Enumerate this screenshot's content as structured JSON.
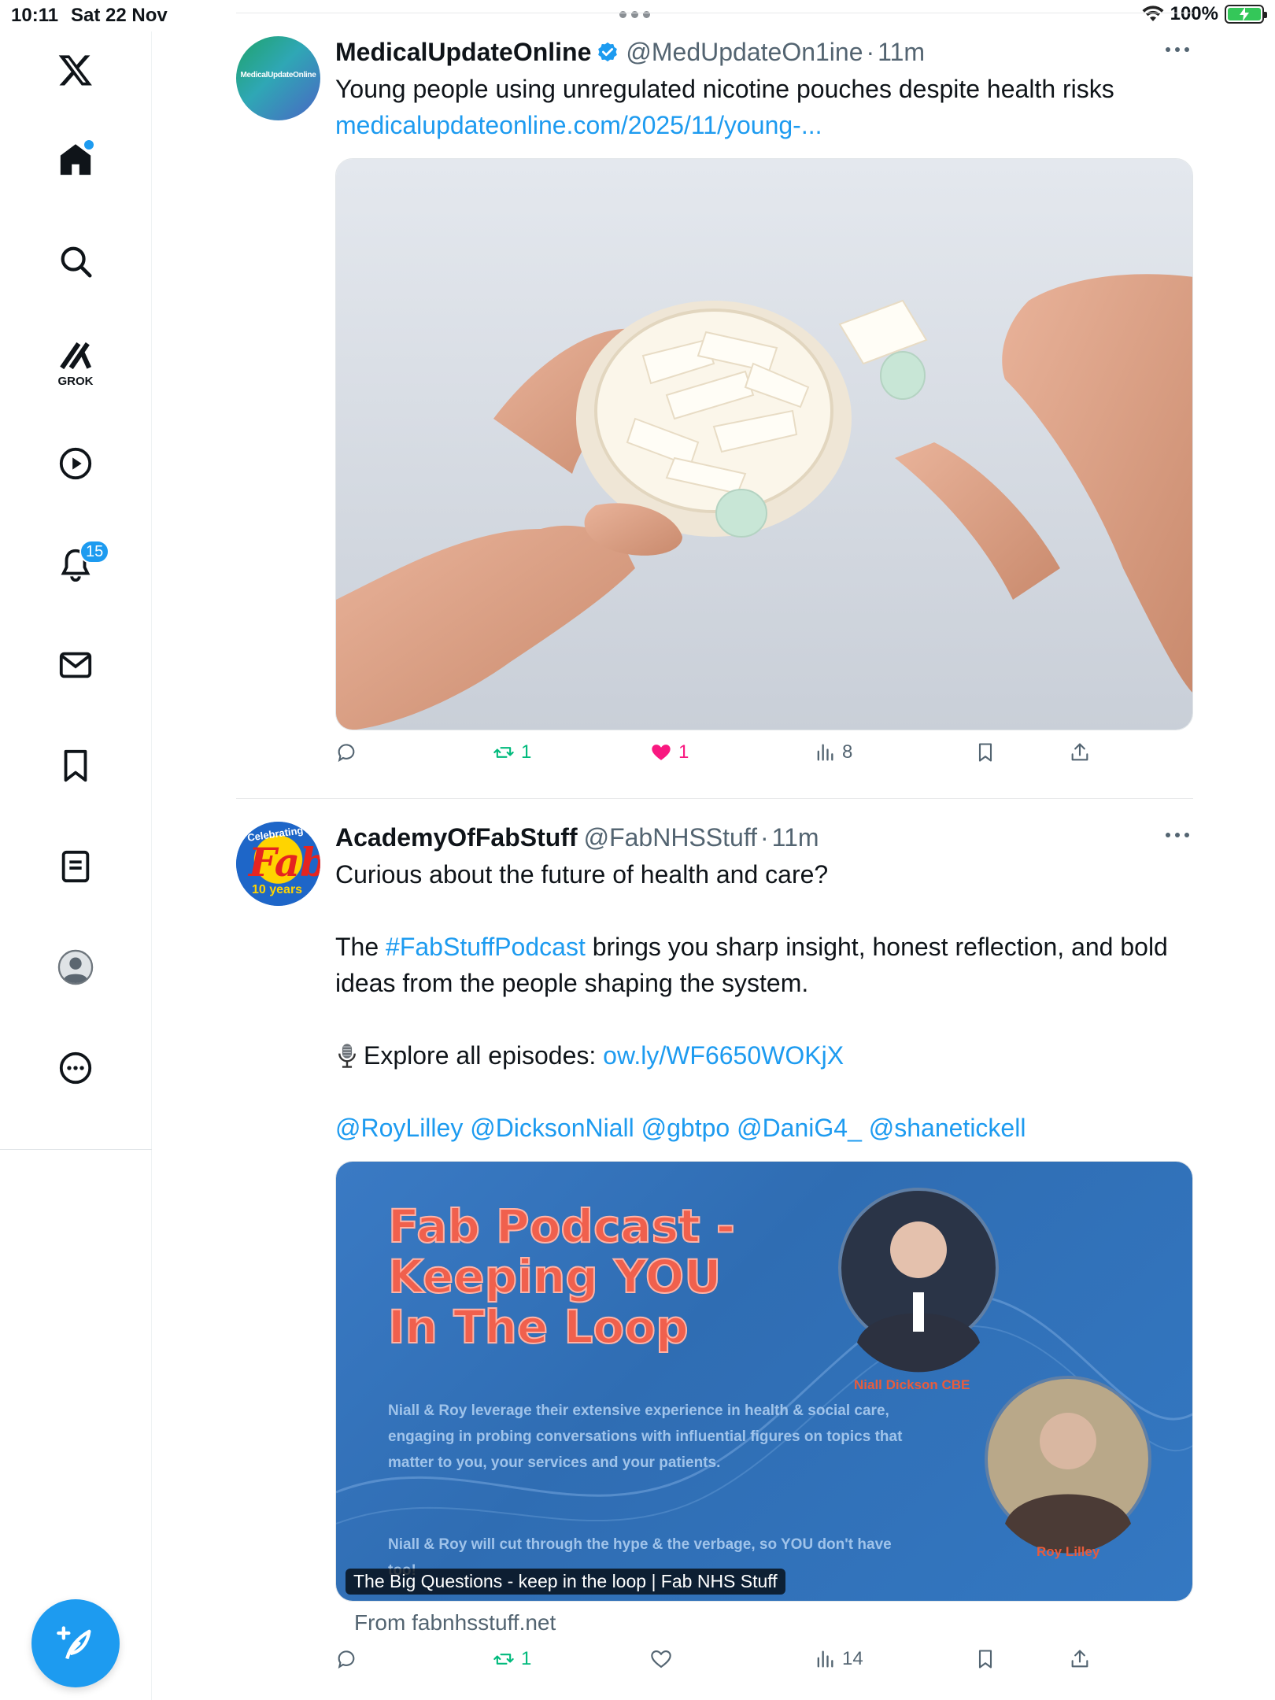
{
  "status_bar": {
    "time": "10:11",
    "date": "Sat 22 Nov",
    "battery": "100%"
  },
  "sidebar": {
    "grok_label": "GROK",
    "notifications_badge": "15",
    "items": [
      "x-logo",
      "home",
      "search",
      "grok",
      "video",
      "notifications",
      "messages",
      "bookmarks",
      "lists",
      "profile",
      "more"
    ]
  },
  "colors": {
    "accent": "#1d9bf0",
    "like": "#f91880",
    "retweet": "#00ba7c",
    "secondary_text": "#536471"
  },
  "posts": [
    {
      "display_name": "MedicalUpdateOnline",
      "verified": true,
      "handle": "@MedUpdateOn1ine",
      "time": "11m",
      "text": "Young people using unregulated nicotine pouches despite health risks",
      "link": "medicalupdateonline.com/2025/11/young-...",
      "avatar_text": "MedicalUpdateOnline",
      "stats": {
        "replies": "",
        "reposts": "1",
        "likes": "1",
        "views": "8"
      }
    },
    {
      "display_name": "AcademyOfFabStuff",
      "handle": "@FabNHSStuff",
      "time": "11m",
      "line1": "Curious about the future of health and care?",
      "line2_prefix": "The ",
      "hashtag": "#FabStuffPodcast",
      "line2_suffix": " brings you sharp insight, honest reflection, and bold ideas from the people shaping the system.",
      "explore_prefix": "Explore all episodes: ",
      "explore_link": "ow.ly/WF6650WOKjX",
      "mentions": "@RoyLilley @DicksonNiall @gbtpo @DaniG4_ @shanetickell",
      "avatar_text_top": "Celebrating",
      "avatar_text_mid": "Fab",
      "avatar_text_bottom": "10 years",
      "card": {
        "title_lines": [
          "Fab Podcast -",
          "Keeping YOU",
          "In The Loop"
        ],
        "description": "Niall & Roy leverage their extensive experience in health & social care, engaging in probing conversations with influential figures on topics that matter to you, your services and your patients.",
        "description2": "Niall & Roy will cut through the hype & the verbage, so YOU don't have too!",
        "person1": "Niall Dickson CBE",
        "person2": "Roy Lilley",
        "caption": "The Big Questions - keep in the loop | Fab NHS Stuff",
        "from": "From fabnhsstuff.net"
      },
      "stats": {
        "replies": "",
        "reposts": "1",
        "likes": "",
        "views": "14"
      }
    }
  ]
}
